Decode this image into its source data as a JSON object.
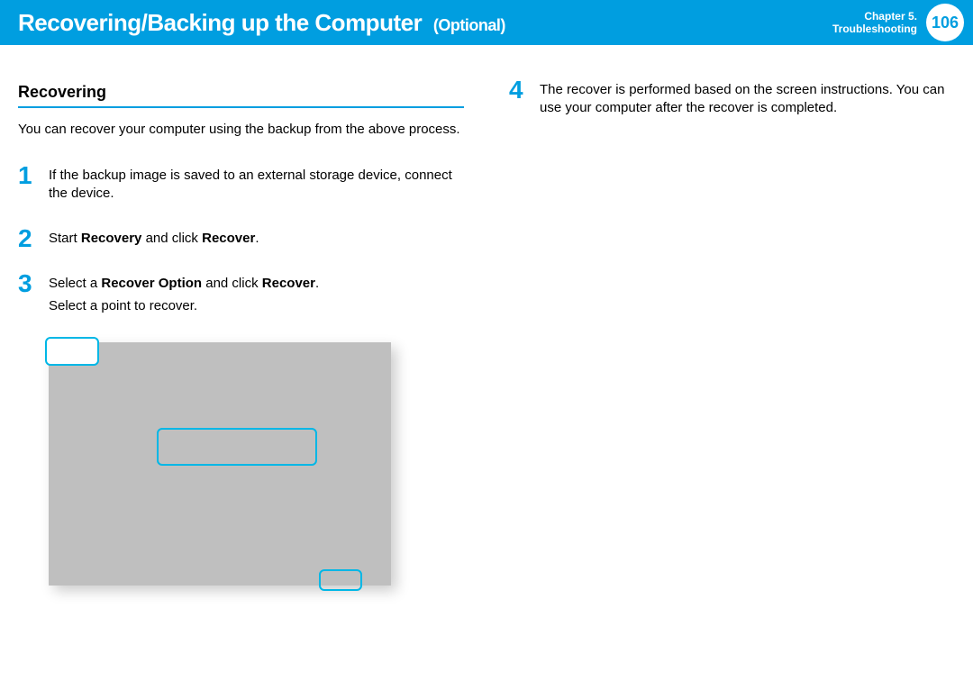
{
  "header": {
    "title_main": "Recovering/Backing up the Computer",
    "title_suffix": "(Optional)",
    "chapter_line1": "Chapter 5.",
    "chapter_line2": "Troubleshooting",
    "page_number": "106"
  },
  "left": {
    "section_title": "Recovering",
    "intro": "You can recover your computer using the backup from the above process.",
    "steps": {
      "s1": {
        "num": "1",
        "text": "If the backup image is saved to an external storage device, connect the device."
      },
      "s2": {
        "num": "2",
        "pre": "Start ",
        "b1": "Recovery",
        "mid": " and click ",
        "b2": "Recover",
        "post": "."
      },
      "s3": {
        "num": "3",
        "pre": "Select a ",
        "b1": "Recover Option",
        "mid": " and click ",
        "b2": "Recover",
        "post": ".",
        "line2": "Select a point to recover."
      }
    }
  },
  "right": {
    "s4": {
      "num": "4",
      "text": "The recover is performed based on the screen instructions. You can use your computer after the recover is completed."
    }
  }
}
